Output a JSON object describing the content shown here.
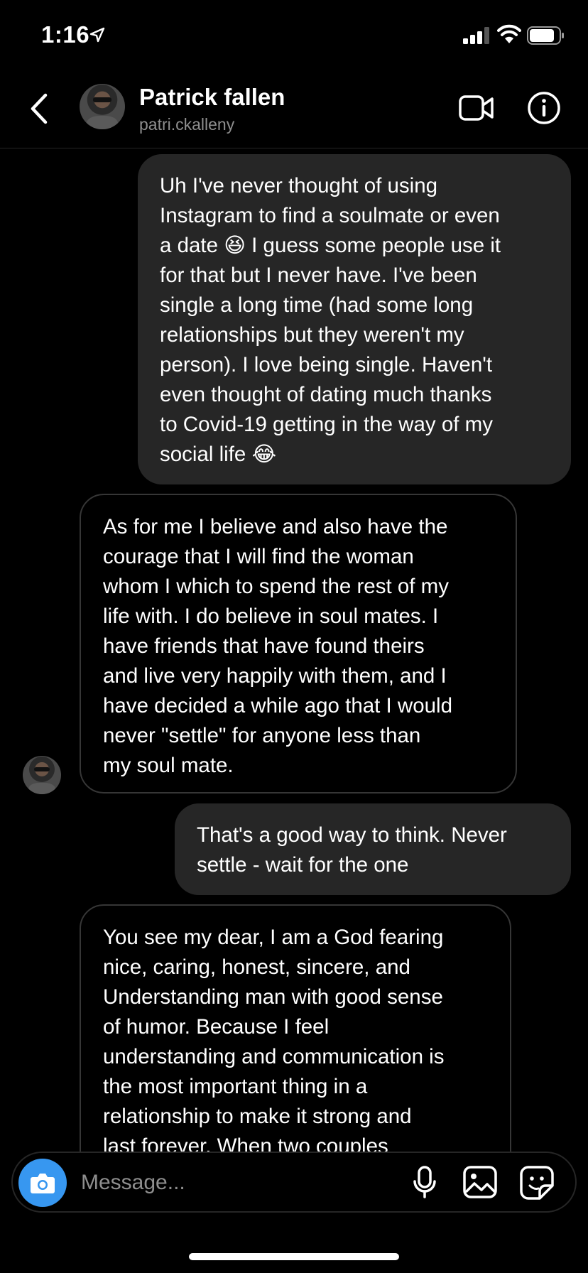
{
  "status_bar": {
    "time": "1:16"
  },
  "header": {
    "contact_name": "Patrick fallen",
    "contact_handle": "patri.ckalleny"
  },
  "messages": [
    {
      "direction": "sent",
      "text": "Uh I've never thought of using\nInstagram to find a soulmate or even\na date 😆 I guess some people use it\nfor that but I never have. I've been\nsingle a long time (had some long\nrelationships but they weren't my\nperson). I love being single. Haven't\neven thought of dating much thanks\nto Covid-19 getting in the way of my\nsocial life 😂"
    },
    {
      "direction": "received",
      "text": "As for me I believe and also have the\ncourage that I will find the woman\nwhom I which to spend the rest of my\nlife with. I do believe in soul mates.  I\nhave friends that have found theirs\nand live very happily with them, and I\nhave decided a while ago that I would\nnever \"settle\" for anyone less than\nmy soul mate."
    },
    {
      "direction": "sent",
      "text": "That's a good way to think. Never\nsettle - wait for the one"
    },
    {
      "direction": "received",
      "text": "You see my dear, I am a God fearing\nnice, caring, honest, sincere, and\nUnderstanding man with good sense\nof humor. Because I feel\nunderstanding and communication is\nthe most important thing in a\nrelationship to make it strong and\nlast forever. When two couples"
    }
  ],
  "composer": {
    "placeholder": "Message..."
  },
  "colors": {
    "background": "#000000",
    "sent_bubble": "#262626",
    "accent": "#3797f0",
    "secondary_text": "#8e8e8e"
  },
  "icons": [
    "location-arrow-icon",
    "signal-icon",
    "wifi-icon",
    "battery-icon",
    "back-chevron-icon",
    "video-call-icon",
    "info-icon",
    "camera-icon",
    "microphone-icon",
    "gallery-icon",
    "sticker-icon"
  ]
}
